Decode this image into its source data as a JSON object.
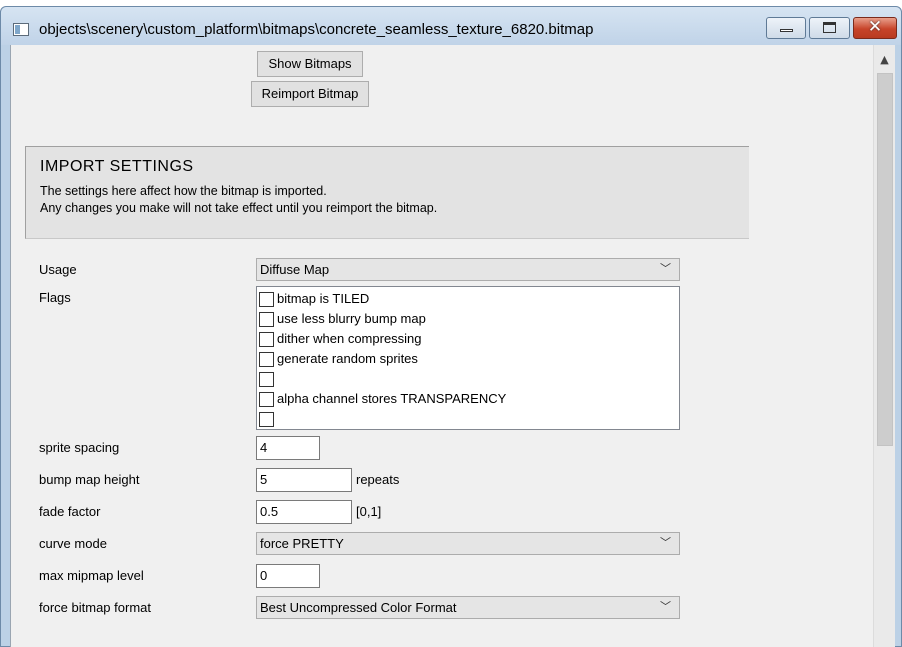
{
  "window": {
    "title": "objects\\scenery\\custom_platform\\bitmaps\\concrete_seamless_texture_6820.bitmap"
  },
  "toolbar": {
    "show_bitmaps_label": "Show Bitmaps",
    "reimport_label": "Reimport Bitmap"
  },
  "import_settings": {
    "heading": "IMPORT SETTINGS",
    "line1": "The settings here affect how the bitmap is imported.",
    "line2": "Any changes you make will not take effect until you reimport the bitmap."
  },
  "fields": {
    "usage": {
      "label": "Usage",
      "value": "Diffuse Map"
    },
    "flags": {
      "label": "Flags",
      "items": [
        {
          "label": "bitmap is TILED",
          "checked": false
        },
        {
          "label": "use less blurry bump map",
          "checked": false
        },
        {
          "label": "dither when compressing",
          "checked": false
        },
        {
          "label": "generate random sprites",
          "checked": false
        },
        {
          "label": "",
          "checked": false
        },
        {
          "label": "alpha channel stores TRANSPARENCY",
          "checked": false
        },
        {
          "label": "",
          "checked": false
        }
      ]
    },
    "sprite_spacing": {
      "label": "sprite spacing",
      "value": "4"
    },
    "bump_map_height": {
      "label": "bump map height",
      "value": "5",
      "suffix": "repeats"
    },
    "fade_factor": {
      "label": "fade factor",
      "value": "0.5",
      "suffix": "[0,1]"
    },
    "curve_mode": {
      "label": "curve mode",
      "value": "force PRETTY"
    },
    "max_mipmap_level": {
      "label": "max mipmap level",
      "value": "0"
    },
    "force_bitmap_format": {
      "label": "force bitmap format",
      "value": "Best Uncompressed Color Format"
    }
  }
}
